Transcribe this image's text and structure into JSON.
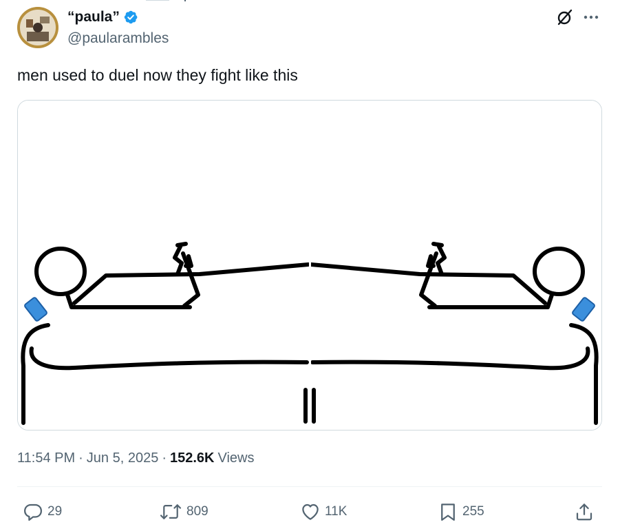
{
  "tweet": {
    "display_name": "“paula”",
    "handle": "@paularambles",
    "verified": true,
    "text": "men used to duel now they fight like this",
    "media_description": "",
    "time": "11:54 PM",
    "date": "Jun 5, 2025",
    "views_count": "152.6K",
    "views_label": "Views"
  },
  "header_icons": [
    "grok-icon",
    "more-icon"
  ],
  "actions": {
    "replies": "29",
    "reposts": "809",
    "likes": "11K",
    "bookmarks": "255"
  },
  "colors": {
    "text_primary": "#0f1419",
    "text_secondary": "#536471",
    "verified_blue": "#1d9bf0",
    "border": "#cfd9de",
    "phone_blue": "#3b8fdc"
  }
}
